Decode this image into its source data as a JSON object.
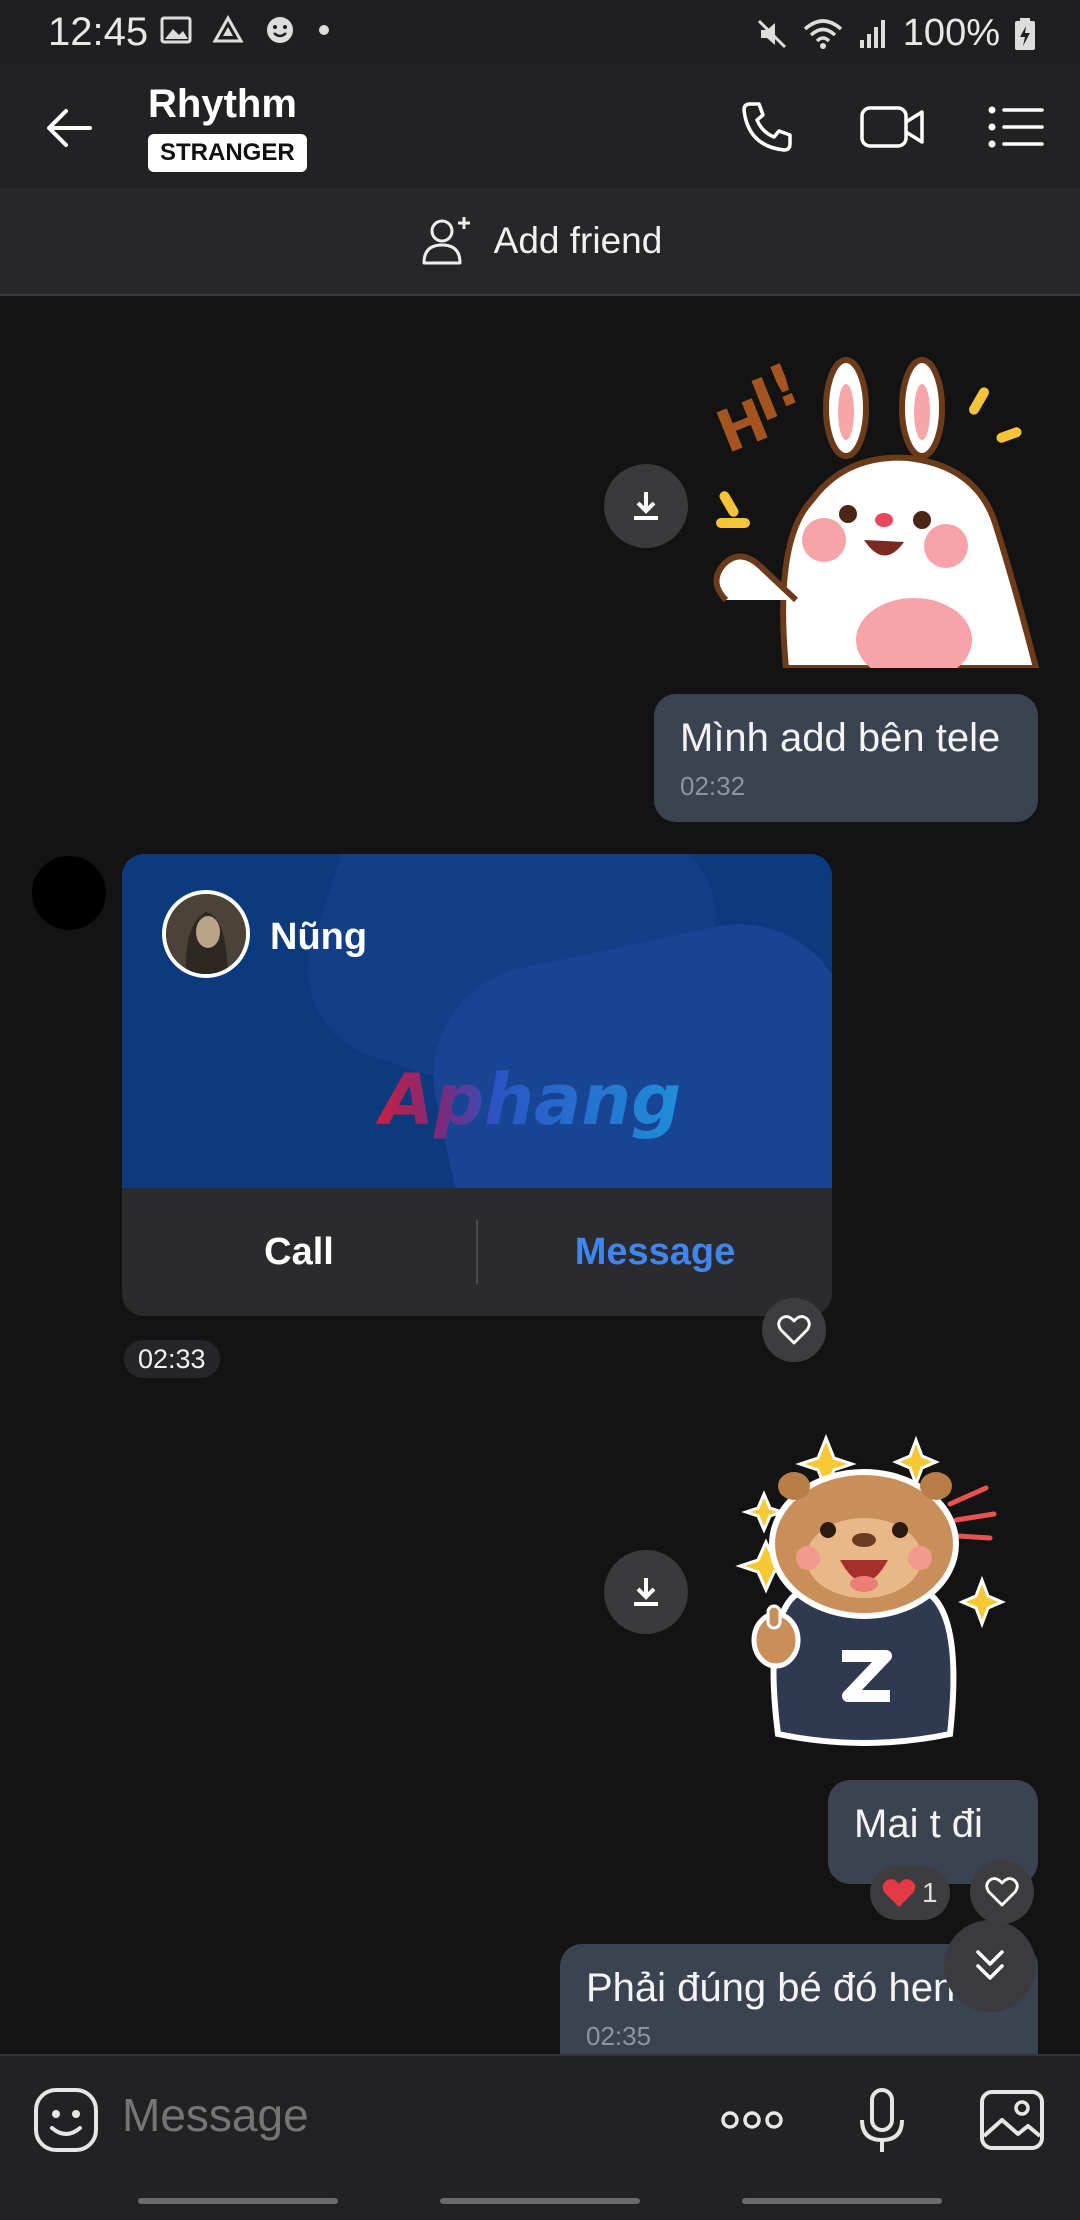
{
  "status": {
    "time": "12:45",
    "battery": "100%"
  },
  "header": {
    "name": "Rhythm",
    "badge": "STRANGER"
  },
  "add_friend": {
    "label": "Add friend"
  },
  "messages": {
    "out_1_text": "Mình add bên tele",
    "out_1_time": "02:32",
    "card_name": "Nũng",
    "card_brand": "Aphang",
    "card_call": "Call",
    "card_message": "Message",
    "card_time": "02:33",
    "out_2_text": "Mai t đi",
    "reaction_count": "1",
    "out_3_text": "Phải đúng bé đó hen",
    "out_3_time": "02:35"
  },
  "input": {
    "placeholder": "Message"
  },
  "colors": {
    "accent_blue": "#3f86f0",
    "bubble_out": "#3b4350",
    "card_bg": "#0c3a7e"
  }
}
